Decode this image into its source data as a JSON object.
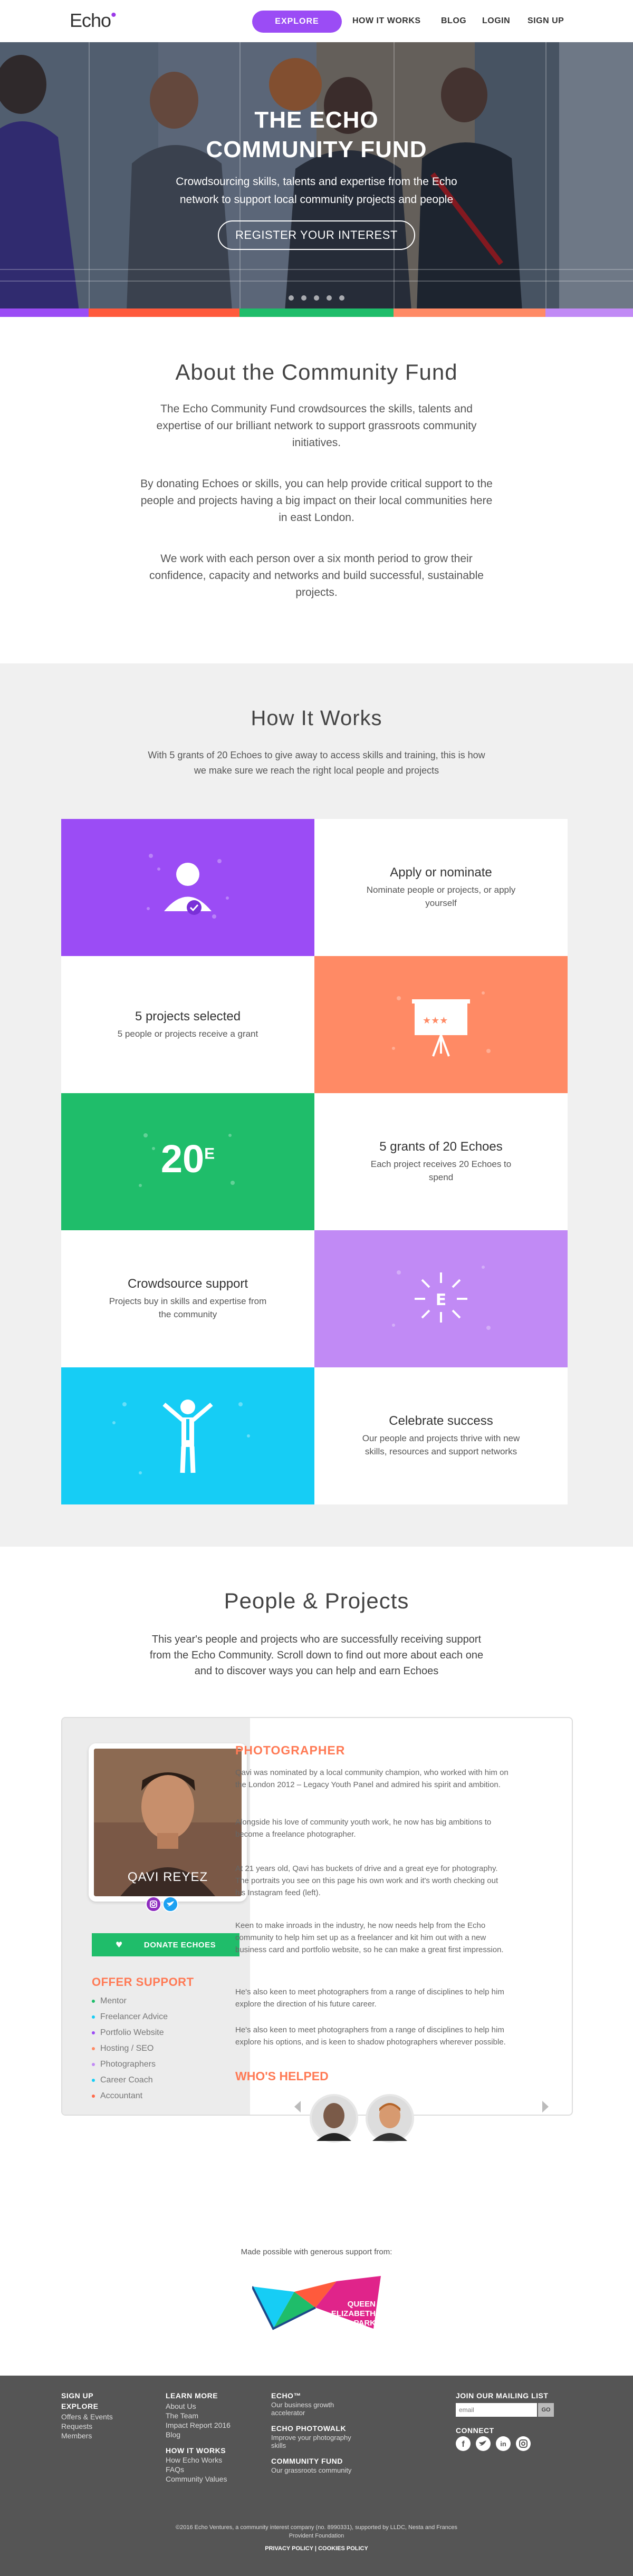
{
  "nav": {
    "logo": "Echo",
    "explore": "EXPLORE",
    "links": [
      "HOW IT WORKS",
      "BLOG",
      "LOGIN",
      "SIGN UP"
    ]
  },
  "hero": {
    "title_line1": "THE ECHO",
    "title_line2": "COMMUNITY FUND",
    "subtitle_line1": "Crowdsourcing skills, talents and expertise from the Echo",
    "subtitle_line2": "network to support local community projects and people",
    "cta": "REGISTER YOUR INTEREST"
  },
  "about": {
    "title": "About the Community Fund",
    "paragraphs": [
      "The Echo Community Fund crowdsources the skills, talents and expertise of our brilliant network to support grassroots community initiatives.",
      "By donating Echoes or skills, you can help provide critical support to the people and projects having a big impact on their local communities here in east London.",
      "We work with each person over a six month period to grow their confidence, capacity and networks and build successful, sustainable projects."
    ]
  },
  "how": {
    "title": "How It Works",
    "intro": "With 5 grants of 20 Echoes to give away to access skills and training, this is how we make sure we reach the right local people and projects",
    "steps": [
      {
        "title": "Apply or nominate",
        "desc": "Nominate people or projects, or apply yourself"
      },
      {
        "title": "5 projects selected",
        "desc": "5 people or projects receive a grant"
      },
      {
        "title": "5 grants of 20 Echoes",
        "desc": "Each project receives 20 Echoes to spend"
      },
      {
        "title": "Crowdsource support",
        "desc": "Projects buy in skills and expertise from the community"
      },
      {
        "title": "Celebrate success",
        "desc": "Our people and projects thrive with new skills, resources and support networks"
      }
    ],
    "big_number": "20",
    "big_number_sup": "E",
    "colors": {
      "purple": "#9b4cf5",
      "orange": "#ff8a65",
      "green": "#1fbd6a",
      "lilac": "#c18af5",
      "cyan": "#16cdf5"
    }
  },
  "people": {
    "title": "People & Projects",
    "intro": "This year's people and projects who are successfully receiving support from the Echo Community. Scroll down to find out more about each one and to discover ways you can help and earn Echoes",
    "profile": {
      "name": "QAVI REYEZ",
      "donate": "DONATE ECHOES",
      "offer_title": "OFFER SUPPORT",
      "offers": [
        {
          "label": "Mentor",
          "color": "#1fbd6a"
        },
        {
          "label": "Freelancer Advice",
          "color": "#16cdf5"
        },
        {
          "label": "Portfolio Website",
          "color": "#9b4cf5"
        },
        {
          "label": "Hosting / SEO",
          "color": "#ff8a65"
        },
        {
          "label": "Photographers",
          "color": "#c18af5"
        },
        {
          "label": "Career Coach",
          "color": "#16cdf5"
        },
        {
          "label": "Accountant",
          "color": "#ff6a4a"
        }
      ],
      "role": "PHOTOGRAPHER",
      "bio": [
        "Qavi was nominated by a local community champion, who worked with him on the London 2012 – Legacy Youth Panel and admired his spirit and ambition.",
        "Alongside his love of community youth work, he now has big ambitions to become a freelance photographer.",
        "At 21 years old, Qavi has buckets of drive and a great eye for photography. The portraits you see on this page his own work and it's worth checking out his Instagram feed (left).",
        "Keen to make inroads in the industry, he now needs help from the Echo community to help him set up as a freelancer and kit him out with a new business card and portfolio website, so he can make a great first impression.",
        "He's also keen to meet photographers from a range of disciplines to help him explore the direction of his future career.",
        "He's also keen to meet photographers from a range of disciplines to help him explore his options, and is keen to shadow photographers wherever possible."
      ],
      "helped_title": "WHO'S HELPED"
    }
  },
  "support": {
    "text": "Made possible with generous support from:",
    "partner_line1": "QUEEN",
    "partner_line2": "ELIZABETH",
    "partner_line3": "OLYMPIC PARK"
  },
  "footer": {
    "col1": {
      "head": "SIGN UP",
      "sub": "EXPLORE",
      "links": [
        "Offers & Events",
        "Requests",
        "Members"
      ]
    },
    "col2": {
      "head": "LEARN MORE",
      "links": [
        "About Us",
        "The Team",
        "Impact Report 2016",
        "Blog"
      ],
      "head2": "HOW IT WORKS",
      "links2": [
        "How Echo Works",
        "FAQs",
        "Community Values"
      ]
    },
    "col3": {
      "head": "ECHO™",
      "desc": "Our business growth accelerator",
      "head2": "ECHO PHOTOWALK",
      "desc2": "Improve your photography skills",
      "head3": "COMMUNITY FUND",
      "desc3": "Our grassroots community"
    },
    "col4": {
      "head": "JOIN OUR MAILING LIST",
      "placeholder": "email",
      "go": "GO",
      "connect": "CONNECT"
    },
    "copyright": "©2016 Echo Ventures, a community interest company (no. 8990331), supported by LLDC, Nesta and Frances Provident Foundation",
    "legal": "PRIVACY POLICY | COOKIES POLICY"
  }
}
